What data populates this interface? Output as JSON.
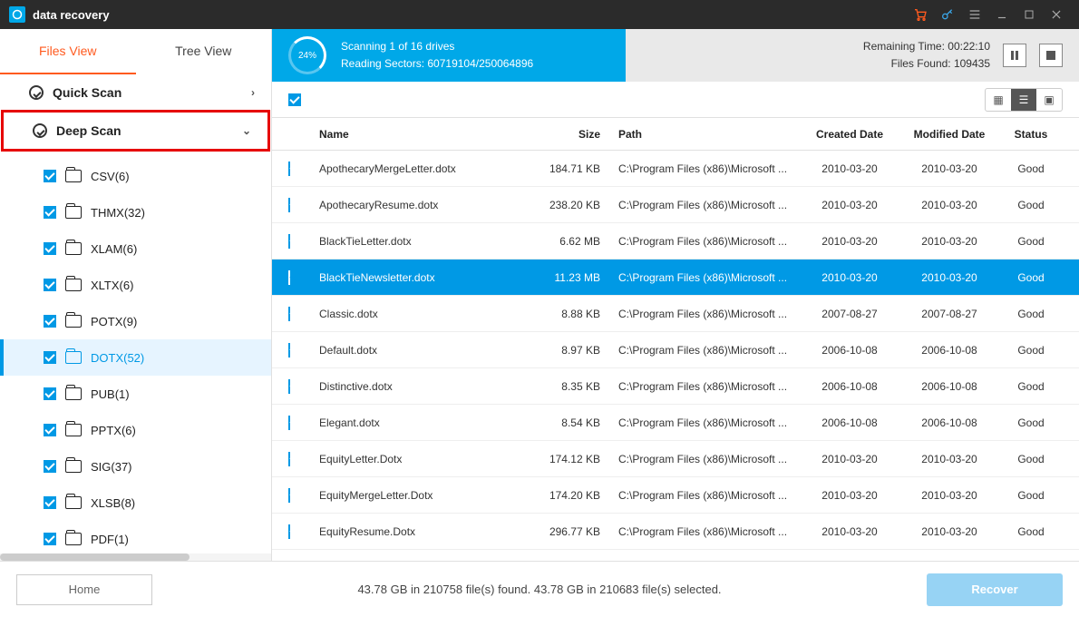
{
  "app_title": "data recovery",
  "titlebar_icons": [
    "cart-icon",
    "key-icon",
    "menu-icon",
    "minimize-icon",
    "maximize-icon",
    "close-icon"
  ],
  "view_tabs": {
    "files": "Files View",
    "tree": "Tree View",
    "active": "files"
  },
  "sections": {
    "quick": "Quick Scan",
    "deep": "Deep Scan"
  },
  "tree_items": [
    {
      "label": "CSV(6)",
      "active": false
    },
    {
      "label": "THMX(32)",
      "active": false
    },
    {
      "label": "XLAM(6)",
      "active": false
    },
    {
      "label": "XLTX(6)",
      "active": false
    },
    {
      "label": "POTX(9)",
      "active": false
    },
    {
      "label": "DOTX(52)",
      "active": true
    },
    {
      "label": "PUB(1)",
      "active": false
    },
    {
      "label": "PPTX(6)",
      "active": false
    },
    {
      "label": "SIG(37)",
      "active": false
    },
    {
      "label": "XLSB(8)",
      "active": false
    },
    {
      "label": "PDF(1)",
      "active": false
    }
  ],
  "progress": {
    "percent": "24%",
    "line1": "Scanning 1 of  16 drives",
    "line2": "Reading Sectors: 60719104/250064896",
    "remaining": "Remaining Time: 00:22:10",
    "found": "Files Found: 109435"
  },
  "columns": {
    "name": "Name",
    "size": "Size",
    "path": "Path",
    "created": "Created Date",
    "modified": "Modified Date",
    "status": "Status"
  },
  "rows": [
    {
      "name": "ApothecaryMergeLetter.dotx",
      "size": "184.71 KB",
      "path": "C:\\Program Files (x86)\\Microsoft ...",
      "created": "2010-03-20",
      "modified": "2010-03-20",
      "status": "Good",
      "selected": false
    },
    {
      "name": "ApothecaryResume.dotx",
      "size": "238.20 KB",
      "path": "C:\\Program Files (x86)\\Microsoft ...",
      "created": "2010-03-20",
      "modified": "2010-03-20",
      "status": "Good",
      "selected": false
    },
    {
      "name": "BlackTieLetter.dotx",
      "size": "6.62 MB",
      "path": "C:\\Program Files (x86)\\Microsoft ...",
      "created": "2010-03-20",
      "modified": "2010-03-20",
      "status": "Good",
      "selected": false
    },
    {
      "name": "BlackTieNewsletter.dotx",
      "size": "11.23 MB",
      "path": "C:\\Program Files (x86)\\Microsoft ...",
      "created": "2010-03-20",
      "modified": "2010-03-20",
      "status": "Good",
      "selected": true
    },
    {
      "name": "Classic.dotx",
      "size": "8.88 KB",
      "path": "C:\\Program Files (x86)\\Microsoft ...",
      "created": "2007-08-27",
      "modified": "2007-08-27",
      "status": "Good",
      "selected": false
    },
    {
      "name": "Default.dotx",
      "size": "8.97 KB",
      "path": "C:\\Program Files (x86)\\Microsoft ...",
      "created": "2006-10-08",
      "modified": "2006-10-08",
      "status": "Good",
      "selected": false
    },
    {
      "name": "Distinctive.dotx",
      "size": "8.35 KB",
      "path": "C:\\Program Files (x86)\\Microsoft ...",
      "created": "2006-10-08",
      "modified": "2006-10-08",
      "status": "Good",
      "selected": false
    },
    {
      "name": "Elegant.dotx",
      "size": "8.54 KB",
      "path": "C:\\Program Files (x86)\\Microsoft ...",
      "created": "2006-10-08",
      "modified": "2006-10-08",
      "status": "Good",
      "selected": false
    },
    {
      "name": "EquityLetter.Dotx",
      "size": "174.12 KB",
      "path": "C:\\Program Files (x86)\\Microsoft ...",
      "created": "2010-03-20",
      "modified": "2010-03-20",
      "status": "Good",
      "selected": false
    },
    {
      "name": "EquityMergeLetter.Dotx",
      "size": "174.20 KB",
      "path": "C:\\Program Files (x86)\\Microsoft ...",
      "created": "2010-03-20",
      "modified": "2010-03-20",
      "status": "Good",
      "selected": false
    },
    {
      "name": "EquityResume.Dotx",
      "size": "296.77 KB",
      "path": "C:\\Program Files (x86)\\Microsoft ...",
      "created": "2010-03-20",
      "modified": "2010-03-20",
      "status": "Good",
      "selected": false
    }
  ],
  "footer": {
    "home": "Home",
    "summary": "43.78 GB in 210758 file(s) found.   43.78 GB in 210683 file(s) selected.",
    "recover": "Recover"
  }
}
